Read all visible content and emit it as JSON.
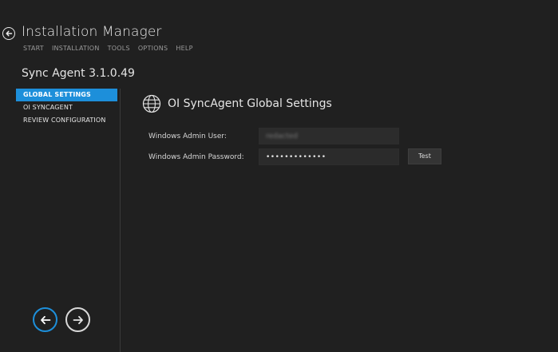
{
  "window": {
    "title": "Installation Manager"
  },
  "top_menu": [
    {
      "label": "START"
    },
    {
      "label": "INSTALLATION"
    },
    {
      "label": "TOOLS"
    },
    {
      "label": "OPTIONS"
    },
    {
      "label": "HELP"
    }
  ],
  "product": {
    "name": "Sync Agent 3.1.0.49"
  },
  "nav": [
    {
      "label": "GLOBAL SETTINGS",
      "active": true
    },
    {
      "label": "OI SYNCAGENT",
      "active": false
    },
    {
      "label": "REVIEW CONFIGURATION",
      "active": false
    }
  ],
  "section": {
    "icon": "globe-icon",
    "title": "OI SyncAgent Global Settings"
  },
  "form": {
    "admin_user_label": "Windows Admin User:",
    "admin_user_value": "redacted",
    "admin_password_label": "Windows Admin Password:",
    "admin_password_value": "•••••••••••••",
    "test_label": "Test"
  },
  "bottom_nav": {
    "back_icon": "arrow-left-icon",
    "next_icon": "arrow-right-icon"
  },
  "colors": {
    "background": "#202020",
    "accent": "#1d8fda",
    "text": "#e6e6e6",
    "muted": "#9a9a9a"
  }
}
